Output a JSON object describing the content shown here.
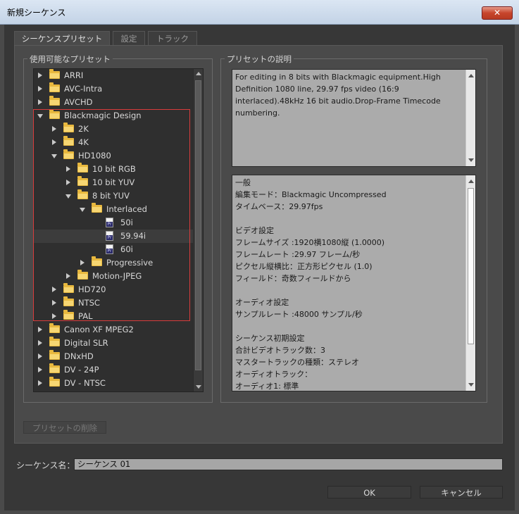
{
  "window": {
    "title": "新規シーケンス",
    "close_label": "✕"
  },
  "tabs": [
    {
      "label": "シーケンスプリセット",
      "active": true
    },
    {
      "label": "設定",
      "active": false
    },
    {
      "label": "トラック",
      "active": false
    }
  ],
  "presets_group": {
    "title": "使用可能なプリセット"
  },
  "preset_tree": [
    {
      "label": "ARRI",
      "type": "folder",
      "depth": 0,
      "expanded": false
    },
    {
      "label": "AVC-Intra",
      "type": "folder",
      "depth": 0,
      "expanded": false
    },
    {
      "label": "AVCHD",
      "type": "folder",
      "depth": 0,
      "expanded": false
    },
    {
      "label": "Blackmagic Design",
      "type": "folder",
      "depth": 0,
      "expanded": true
    },
    {
      "label": "2K",
      "type": "folder",
      "depth": 1,
      "expanded": false
    },
    {
      "label": "4K",
      "type": "folder",
      "depth": 1,
      "expanded": false
    },
    {
      "label": "HD1080",
      "type": "folder",
      "depth": 1,
      "expanded": true
    },
    {
      "label": "10 bit RGB",
      "type": "folder",
      "depth": 2,
      "expanded": false
    },
    {
      "label": "10 bit YUV",
      "type": "folder",
      "depth": 2,
      "expanded": false
    },
    {
      "label": "8 bit YUV",
      "type": "folder",
      "depth": 2,
      "expanded": true
    },
    {
      "label": "Interlaced",
      "type": "folder",
      "depth": 3,
      "expanded": true
    },
    {
      "label": "50i",
      "type": "file",
      "depth": 4
    },
    {
      "label": "59.94i",
      "type": "file",
      "depth": 4,
      "selected": true
    },
    {
      "label": "60i",
      "type": "file",
      "depth": 4
    },
    {
      "label": "Progressive",
      "type": "folder",
      "depth": 3,
      "expanded": false
    },
    {
      "label": "Motion-JPEG",
      "type": "folder",
      "depth": 2,
      "expanded": false
    },
    {
      "label": "HD720",
      "type": "folder",
      "depth": 1,
      "expanded": false
    },
    {
      "label": "NTSC",
      "type": "folder",
      "depth": 1,
      "expanded": false
    },
    {
      "label": "PAL",
      "type": "folder",
      "depth": 1,
      "expanded": false
    },
    {
      "label": "Canon XF MPEG2",
      "type": "folder",
      "depth": 0,
      "expanded": false
    },
    {
      "label": "Digital SLR",
      "type": "folder",
      "depth": 0,
      "expanded": false
    },
    {
      "label": "DNxHD",
      "type": "folder",
      "depth": 0,
      "expanded": false
    },
    {
      "label": "DV - 24P",
      "type": "folder",
      "depth": 0,
      "expanded": false
    },
    {
      "label": "DV - NTSC",
      "type": "folder",
      "depth": 0,
      "expanded": false
    }
  ],
  "file_icon_text": "Pr",
  "description_group": {
    "title": "プリセットの説明",
    "text": "For editing in 8 bits with Blackmagic equipment.High Definition 1080 line, 29.97 fps video (16:9 interlaced).48kHz 16 bit audio.Drop-Frame Timecode numbering."
  },
  "details": [
    "一般",
    " 編集モード：Blackmagic Uncompressed",
    " タイムベース：29.97fps",
    "",
    "ビデオ設定",
    " フレームサイズ :1920横1080縦 (1.0000)",
    " フレームレート :29.97 フレーム/秒",
    " ピクセル縦横比：正方形ピクセル (1.0)",
    " フィールド：奇数フィールドから",
    "",
    "オーディオ設定",
    " サンプルレート :48000 サンプル/秒",
    "",
    "シーケンス初期設定",
    " 合計ビデオトラック数：3",
    " マスタートラックの種類：ステレオ",
    " オーディオトラック：",
    " オーディオ1: 標準"
  ],
  "delete_preset_label": "プリセットの削除",
  "sequence_name": {
    "label": "シーケンス名：",
    "value": "シーケンス 01"
  },
  "ok_label": "OK",
  "cancel_label": "キャンセル"
}
